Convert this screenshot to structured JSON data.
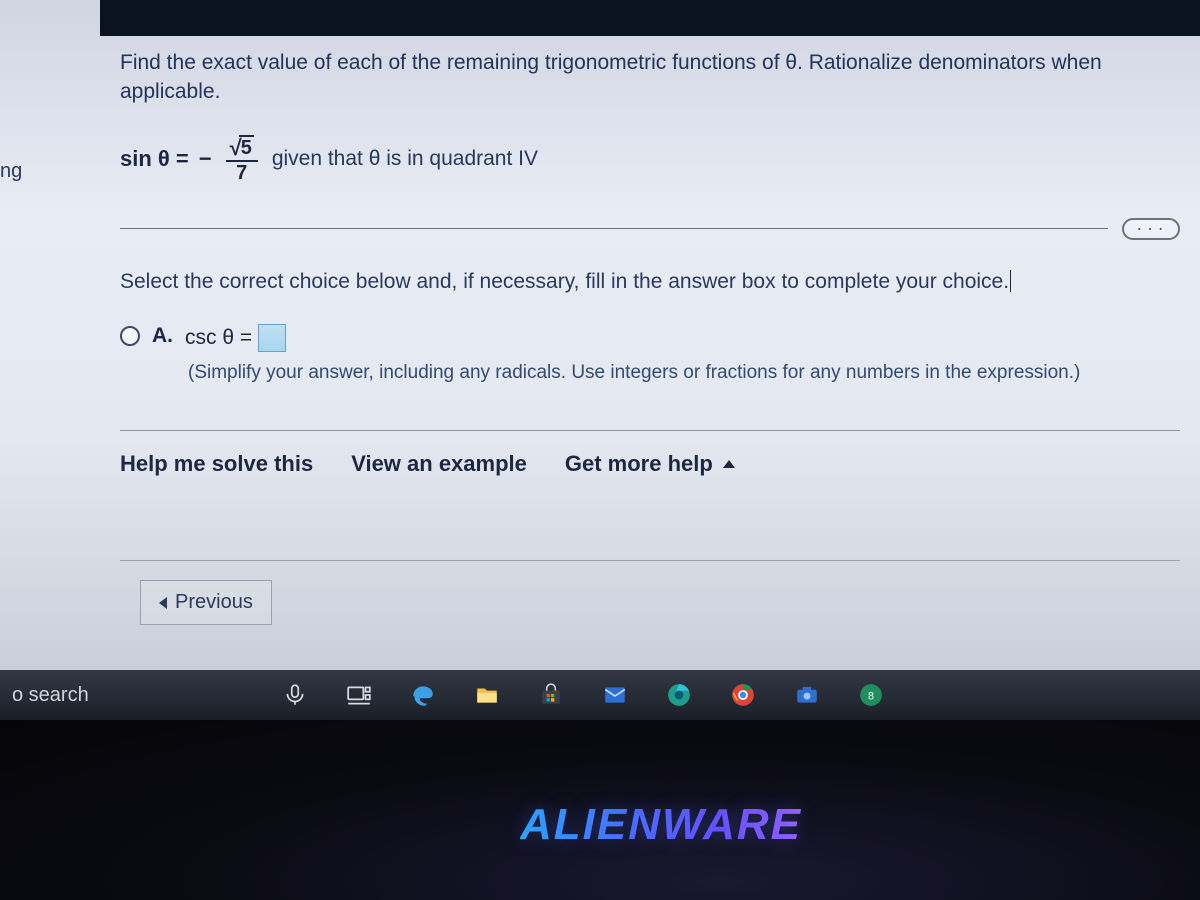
{
  "nav": {
    "item1": "ng",
    "item2": "to search"
  },
  "question": {
    "prompt": "Find the exact value of each of the remaining trigonometric functions of θ. Rationalize denominators when applicable.",
    "lhs": "sin θ =",
    "neg": "−",
    "num_radicand": "5",
    "den": "7",
    "given": "given that θ is in quadrant IV",
    "ellipsis": "∙ ∙ ∙"
  },
  "instruction": "Select the correct choice below and, if necessary, fill in the answer box to complete your choice.",
  "choice": {
    "letter": "A.",
    "expr_lhs": "csc θ =",
    "hint": "(Simplify your answer, including any radicals. Use integers or fractions for any numbers in the expression.)"
  },
  "helpbar": {
    "solve": "Help me solve this",
    "example": "View an example",
    "more": "Get more help"
  },
  "prev": "Previous",
  "taskbar": {
    "search": "o search"
  },
  "brand": "ALIENWARE",
  "icons": {
    "mic": "mic-icon",
    "taskview": "task-view-icon",
    "edge_legacy": "edge-legacy-icon",
    "explorer": "file-explorer-icon",
    "store": "microsoft-store-icon",
    "mail": "mail-icon",
    "edge": "edge-chromium-icon",
    "chrome": "chrome-icon",
    "camera": "camera-icon",
    "app": "app-icon"
  }
}
